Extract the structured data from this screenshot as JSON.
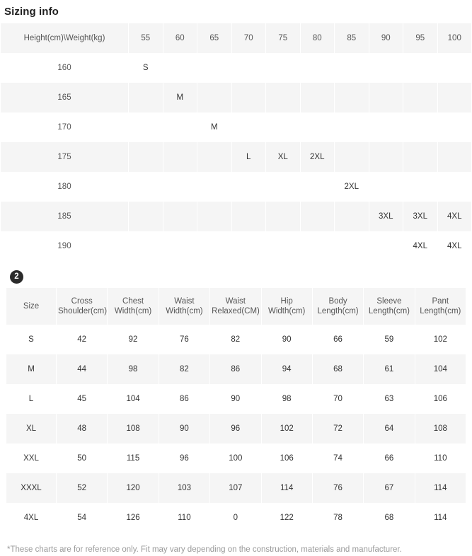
{
  "header": {
    "title": "Sizing info"
  },
  "step_badge": {
    "label": "2"
  },
  "size_chart": {
    "corner_label": "Height(cm)\\Weight(kg)",
    "weights": [
      "55",
      "60",
      "65",
      "70",
      "75",
      "80",
      "85",
      "90",
      "95",
      "100"
    ],
    "rows": [
      {
        "height": "160",
        "cells": [
          "S",
          "",
          "",
          "",
          "",
          "",
          "",
          "",
          "",
          ""
        ]
      },
      {
        "height": "165",
        "cells": [
          "",
          "M",
          "",
          "",
          "",
          "",
          "",
          "",
          "",
          ""
        ]
      },
      {
        "height": "170",
        "cells": [
          "",
          "",
          "M",
          "",
          "",
          "",
          "",
          "",
          "",
          ""
        ]
      },
      {
        "height": "175",
        "cells": [
          "",
          "",
          "",
          "L",
          "XL",
          "2XL",
          "",
          "",
          "",
          ""
        ]
      },
      {
        "height": "180",
        "cells": [
          "",
          "",
          "",
          "",
          "",
          "",
          "2XL",
          "",
          "",
          ""
        ]
      },
      {
        "height": "185",
        "cells": [
          "",
          "",
          "",
          "",
          "",
          "",
          "",
          "3XL",
          "3XL",
          "4XL"
        ]
      },
      {
        "height": "190",
        "cells": [
          "",
          "",
          "",
          "",
          "",
          "",
          "",
          "",
          "4XL",
          "4XL"
        ]
      }
    ]
  },
  "measurement_chart": {
    "columns": [
      "Size",
      "Cross Shoulder(cm)",
      "Chest Width(cm)",
      "Waist Width(cm)",
      "Waist Relaxed(CM)",
      "Hip Width(cm)",
      "Body Length(cm)",
      "Sleeve Length(cm)",
      "Pant Length(cm)"
    ],
    "rows": [
      [
        "S",
        "42",
        "92",
        "76",
        "82",
        "90",
        "66",
        "59",
        "102"
      ],
      [
        "M",
        "44",
        "98",
        "82",
        "86",
        "94",
        "68",
        "61",
        "104"
      ],
      [
        "L",
        "45",
        "104",
        "86",
        "90",
        "98",
        "70",
        "63",
        "106"
      ],
      [
        "XL",
        "48",
        "108",
        "90",
        "96",
        "102",
        "72",
        "64",
        "108"
      ],
      [
        "XXL",
        "50",
        "115",
        "96",
        "100",
        "106",
        "74",
        "66",
        "110"
      ],
      [
        "XXXL",
        "52",
        "120",
        "103",
        "107",
        "114",
        "76",
        "67",
        "114"
      ],
      [
        "4XL",
        "54",
        "126",
        "110",
        "0",
        "122",
        "78",
        "68",
        "114"
      ]
    ]
  },
  "footnote": {
    "text": "*These charts are for reference only. Fit may vary depending on the construction, materials and manufacturer."
  }
}
